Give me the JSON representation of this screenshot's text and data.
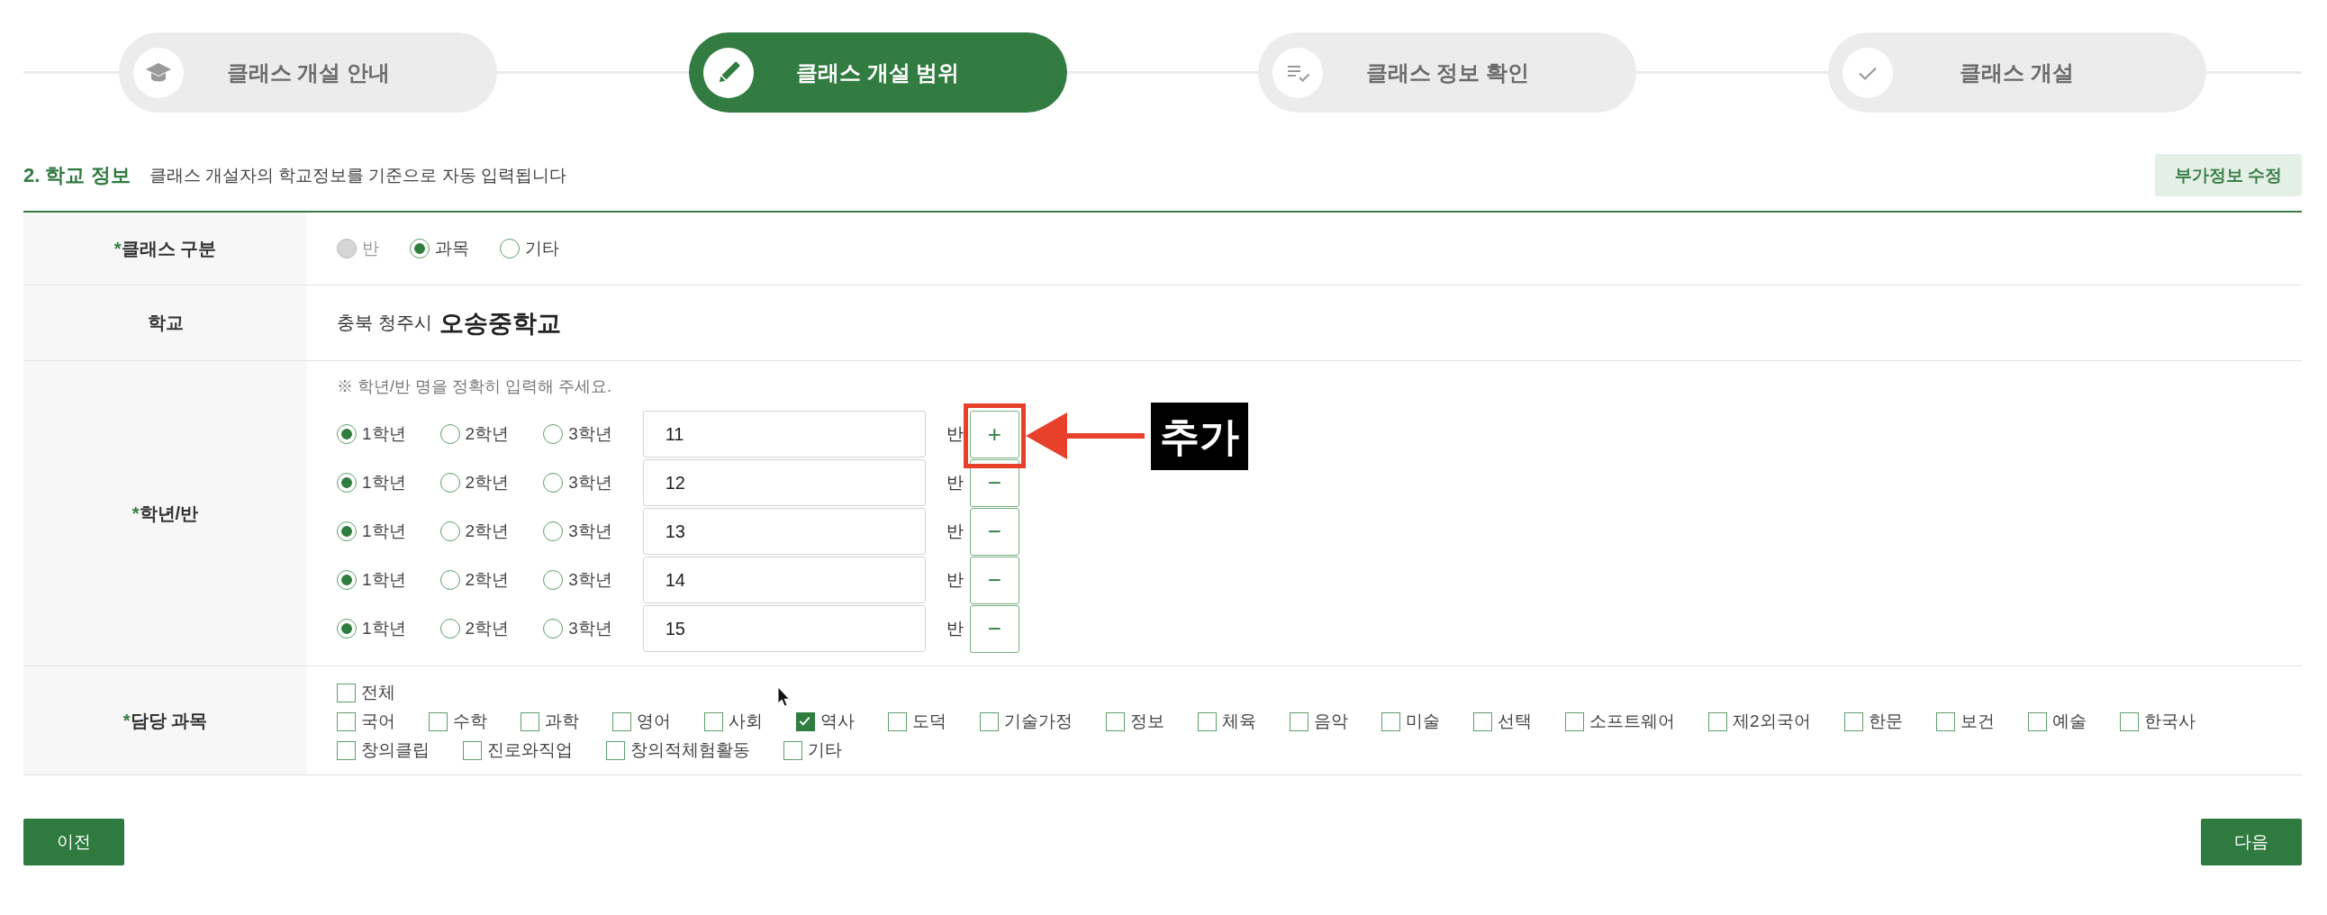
{
  "steps": [
    {
      "label": "클래스 개설 안내",
      "selected": false
    },
    {
      "label": "클래스 개설 범위",
      "selected": true
    },
    {
      "label": "클래스 정보 확인",
      "selected": false
    },
    {
      "label": "클래스 개설",
      "selected": false
    }
  ],
  "section": {
    "title": "2. 학교 정보",
    "description": "클래스 개설자의 학교정보를 기준으로 자동 입력됩니다",
    "edit_button": "부가정보 수정"
  },
  "form": {
    "class_type": {
      "required_mark": "*",
      "label": "클래스 구분",
      "options": [
        {
          "label": "반",
          "selected": false,
          "disabled": true
        },
        {
          "label": "과목",
          "selected": true,
          "disabled": false
        },
        {
          "label": "기타",
          "selected": false,
          "disabled": false
        }
      ]
    },
    "school": {
      "label": "학교",
      "region": "충북 청주시",
      "name": "오송중학교"
    },
    "grade_class": {
      "required_mark": "*",
      "label": "학년/반",
      "note": "※ 학년/반 명을 정확히 입력해 주세요.",
      "rows": [
        {
          "grades": [
            {
              "label": "1학년",
              "selected": true
            },
            {
              "label": "2학년",
              "selected": false
            },
            {
              "label": "3학년",
              "selected": false
            }
          ],
          "value": "11",
          "unit": "반",
          "button": "+",
          "annotation": {
            "label": "추가"
          }
        },
        {
          "grades": [
            {
              "label": "1학년",
              "selected": true
            },
            {
              "label": "2학년",
              "selected": false
            },
            {
              "label": "3학년",
              "selected": false
            }
          ],
          "value": "12",
          "unit": "반",
          "button": "−"
        },
        {
          "grades": [
            {
              "label": "1학년",
              "selected": true
            },
            {
              "label": "2학년",
              "selected": false
            },
            {
              "label": "3학년",
              "selected": false
            }
          ],
          "value": "13",
          "unit": "반",
          "button": "−"
        },
        {
          "grades": [
            {
              "label": "1학년",
              "selected": true
            },
            {
              "label": "2학년",
              "selected": false
            },
            {
              "label": "3학년",
              "selected": false
            }
          ],
          "value": "14",
          "unit": "반",
          "button": "−"
        },
        {
          "grades": [
            {
              "label": "1학년",
              "selected": true
            },
            {
              "label": "2학년",
              "selected": false
            },
            {
              "label": "3학년",
              "selected": false
            }
          ],
          "value": "15",
          "unit": "반",
          "button": "−"
        }
      ]
    },
    "subjects": {
      "required_mark": "*",
      "label": "담당 과목",
      "lines": [
        [
          {
            "label": "전체",
            "checked": false
          }
        ],
        [
          {
            "label": "국어",
            "checked": false
          },
          {
            "label": "수학",
            "checked": false
          },
          {
            "label": "과학",
            "checked": false
          },
          {
            "label": "영어",
            "checked": false
          },
          {
            "label": "사회",
            "checked": false
          },
          {
            "label": "역사",
            "checked": true
          },
          {
            "label": "도덕",
            "checked": false
          },
          {
            "label": "기술가정",
            "checked": false
          },
          {
            "label": "정보",
            "checked": false
          },
          {
            "label": "체육",
            "checked": false
          },
          {
            "label": "음악",
            "checked": false
          },
          {
            "label": "미술",
            "checked": false
          },
          {
            "label": "선택",
            "checked": false
          },
          {
            "label": "소프트웨어",
            "checked": false
          },
          {
            "label": "제2외국어",
            "checked": false
          },
          {
            "label": "한문",
            "checked": false
          },
          {
            "label": "보건",
            "checked": false
          },
          {
            "label": "예술",
            "checked": false
          },
          {
            "label": "한국사",
            "checked": false
          }
        ],
        [
          {
            "label": "창의클립",
            "checked": false
          },
          {
            "label": "진로와직업",
            "checked": false
          },
          {
            "label": "창의적체험활동",
            "checked": false
          },
          {
            "label": "기타",
            "checked": false
          }
        ]
      ]
    }
  },
  "buttons": {
    "previous": "이전",
    "next": "다음"
  }
}
